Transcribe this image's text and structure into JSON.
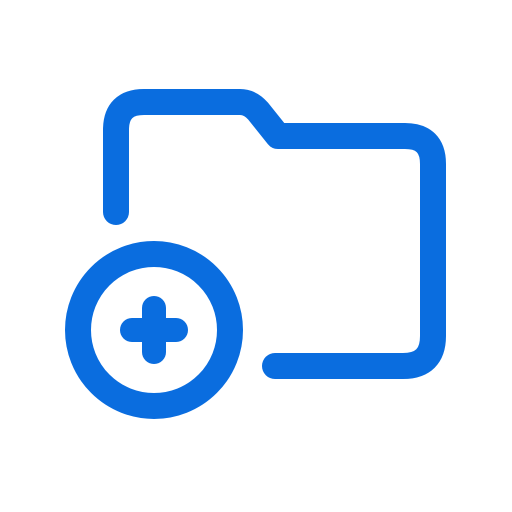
{
  "icon": {
    "name": "folder-add-icon",
    "color": "#0a6ddf",
    "background": "#ffffff"
  }
}
